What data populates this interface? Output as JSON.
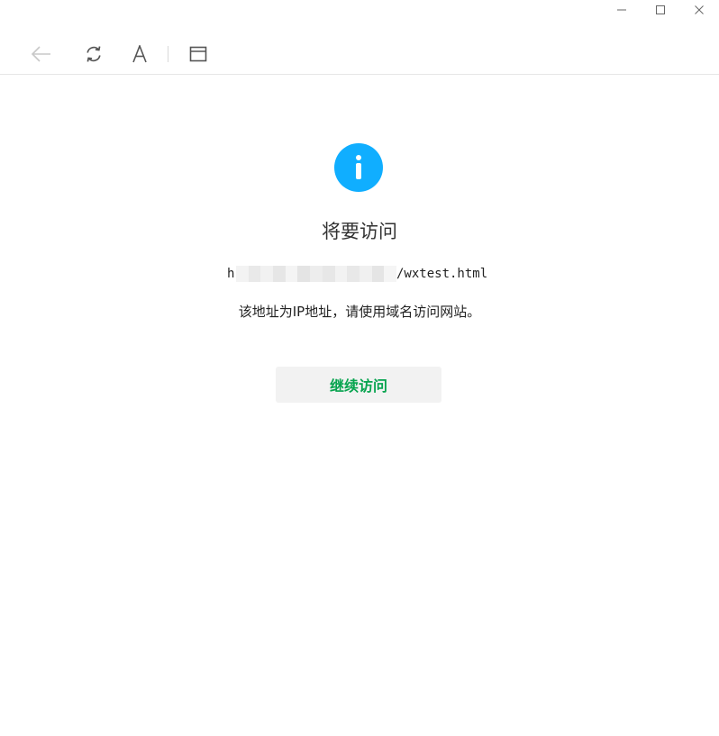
{
  "window_controls": {
    "minimize_icon": "minimize-icon",
    "maximize_icon": "maximize-icon",
    "close_icon": "close-icon"
  },
  "toolbar": {
    "back_icon": "back-arrow-icon",
    "refresh_icon": "refresh-icon",
    "font_icon": "font-size-icon",
    "font_glyph": "A",
    "window_icon": "open-in-window-icon"
  },
  "notice": {
    "icon": "info-icon",
    "title": "将要访问",
    "url_prefix": "h",
    "url_suffix": "/wxtest.html",
    "message": "该地址为IP地址，请使用域名访问网站。",
    "continue_label": "继续访问"
  },
  "colors": {
    "info_blue": "#10aeff",
    "continue_green": "#07a44f",
    "button_bg": "#f2f2f2"
  }
}
